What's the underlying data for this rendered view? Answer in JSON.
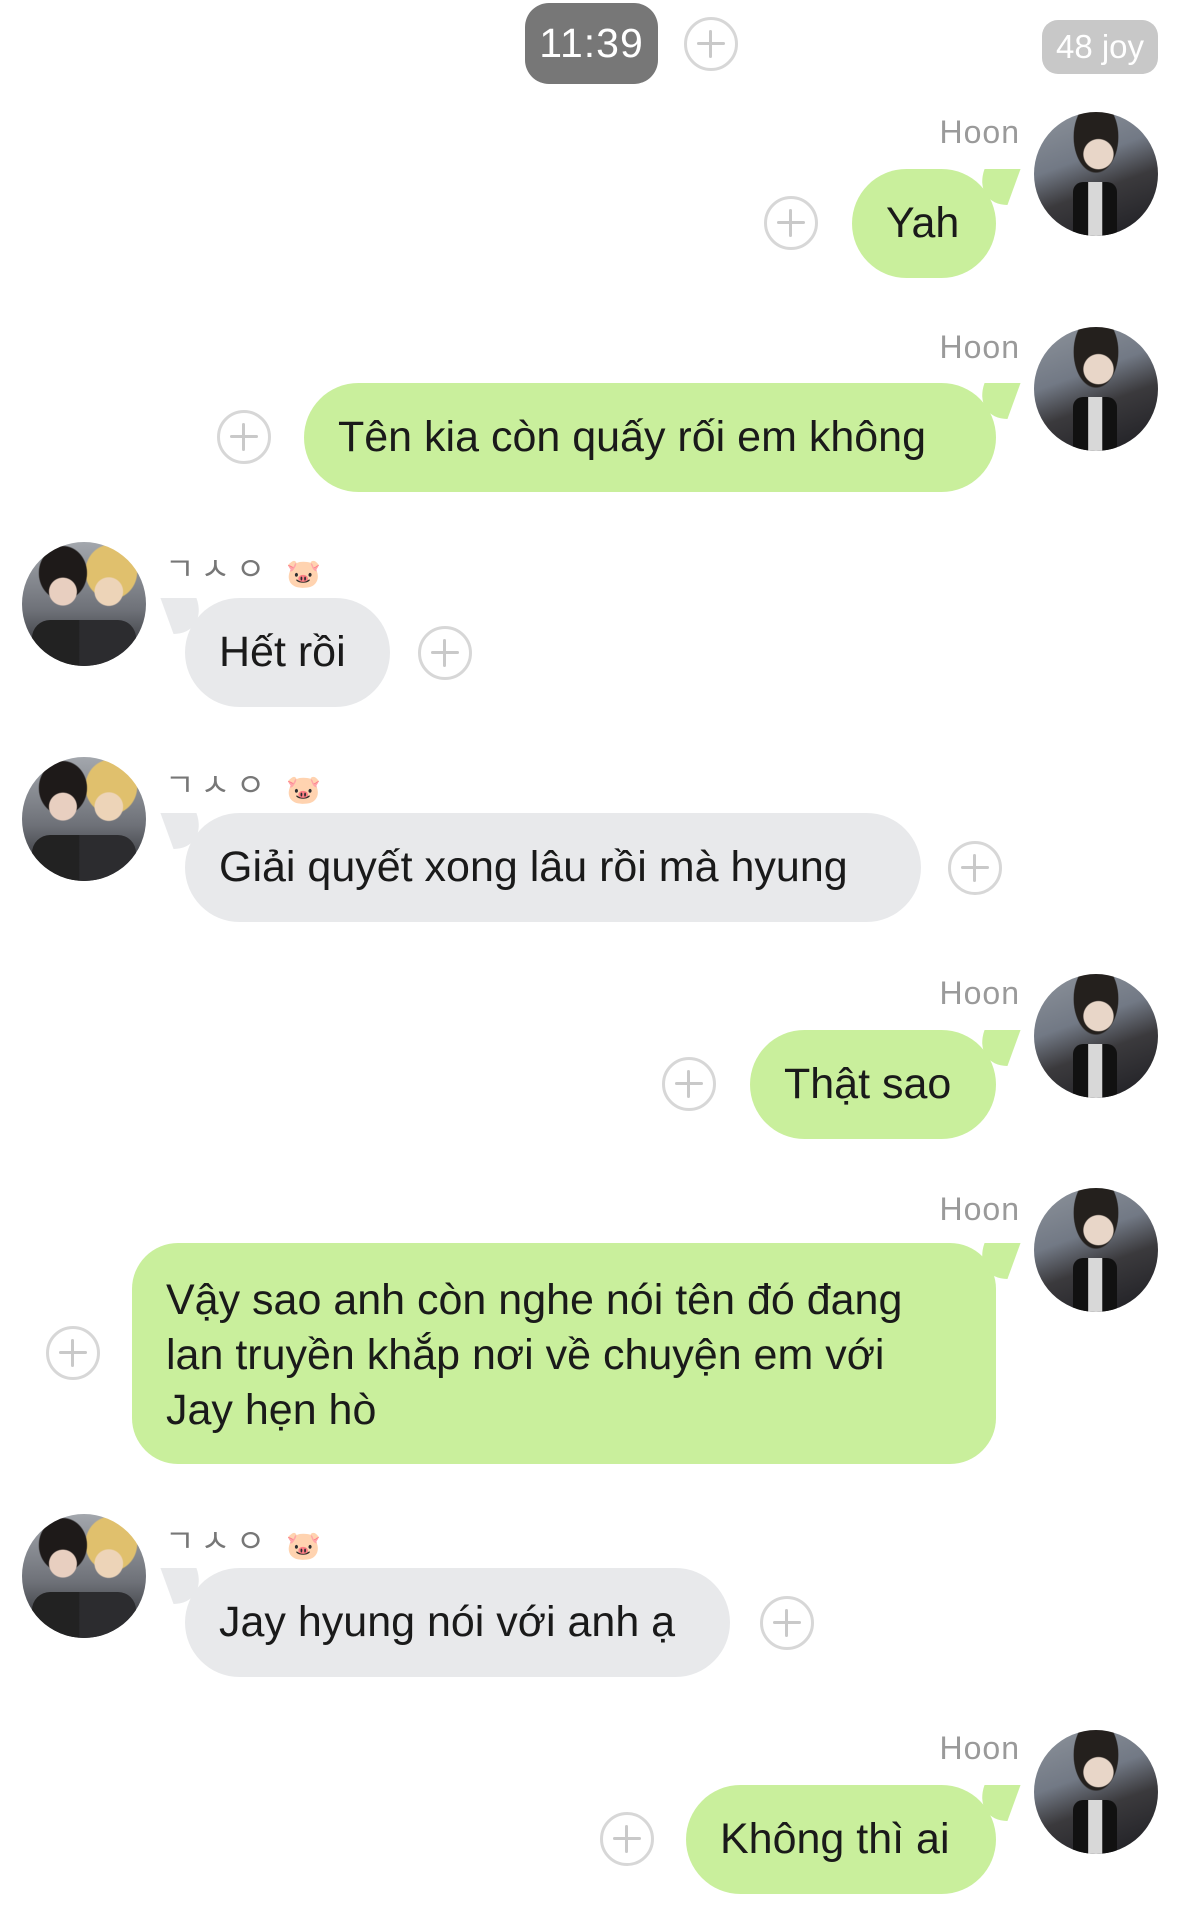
{
  "status": {
    "time": "11:39",
    "badge": "48 joy"
  },
  "messages": [
    {
      "side": "right",
      "sender": "Hoon",
      "text": "Yah"
    },
    {
      "side": "right",
      "sender": "Hoon",
      "text": "Tên kia còn quấy rối em không"
    },
    {
      "side": "left",
      "sender": "ㄱㅅㅇ",
      "text": "Hết rồi"
    },
    {
      "side": "left",
      "sender": "ㄱㅅㅇ",
      "text": "Giải quyết xong lâu rồi mà hyung"
    },
    {
      "side": "right",
      "sender": "Hoon",
      "text": "Thật sao"
    },
    {
      "side": "right",
      "sender": "Hoon",
      "text": "Vậy sao anh còn nghe nói tên đó đang lan truyền khắp nơi về chuyện em với Jay hẹn hò"
    },
    {
      "side": "left",
      "sender": "ㄱㅅㅇ",
      "text": "Jay hyung nói với anh ạ"
    },
    {
      "side": "right",
      "sender": "Hoon",
      "text": "Không thì ai"
    }
  ],
  "icons": {
    "add": "plus-circle-icon",
    "sender_emoji": "🐷"
  },
  "colors": {
    "mine_bubble": "#c9ef9c",
    "theirs_bubble": "#e8e9eb",
    "time_pill": "#777777"
  }
}
